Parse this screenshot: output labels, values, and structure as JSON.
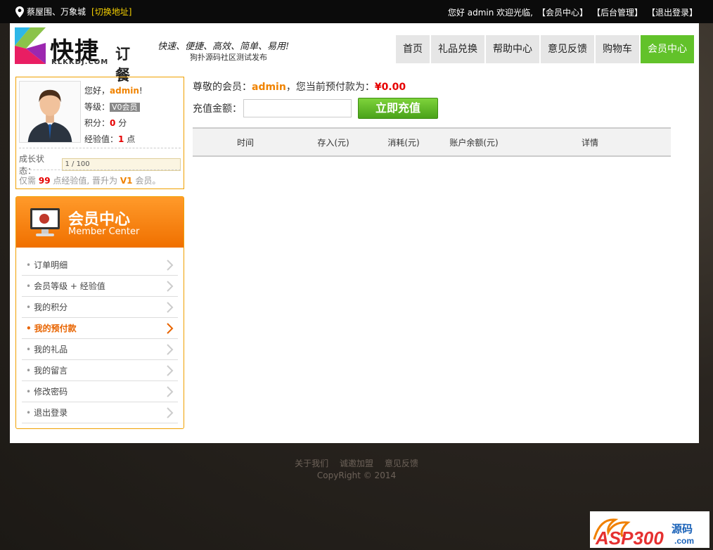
{
  "topbar": {
    "location": "蔡屋围、万象城",
    "switch_label": "[切换地址]",
    "welcome": "您好 admin 欢迎光临,",
    "links": [
      "【会员中心】",
      "【后台管理】",
      "【退出登录】"
    ]
  },
  "header": {
    "logo_name": "快捷",
    "logo_sub": "订餐",
    "logo_url": "KLKKDJ.COM",
    "slogan": "快速、便捷、高效、简单、易用!",
    "subslogan": "狗扑源码社区测试发布",
    "nav": [
      {
        "label": "首页",
        "active": false
      },
      {
        "label": "礼品兑换",
        "active": false
      },
      {
        "label": "帮助中心",
        "active": false
      },
      {
        "label": "意见反馈",
        "active": false
      },
      {
        "label": "购物车",
        "active": false
      },
      {
        "label": "会员中心",
        "active": true
      }
    ]
  },
  "profile": {
    "hello": "您好，",
    "username": "admin",
    "excl": "!",
    "level_label": "等级：",
    "level_value": "V0会员",
    "points_label": "积分：",
    "points_value": "0",
    "points_unit": "分",
    "exp_label": "经验值：",
    "exp_value": "1",
    "exp_unit": "点",
    "growth_label": "成长状态：",
    "growth_text": "1 / 100",
    "tip_pre": "仅需",
    "tip_num": "99",
    "tip_mid": "点经验值, 晋升为",
    "tip_level": "V1",
    "tip_post": "会员。"
  },
  "member_menu": {
    "title_cn": "会员中心",
    "title_en": "Member Center",
    "items": [
      {
        "label": "订单明细",
        "active": false
      },
      {
        "label": "会员等级 + 经验值",
        "active": false
      },
      {
        "label": "我的积分",
        "active": false
      },
      {
        "label": "我的预付款",
        "active": true
      },
      {
        "label": "我的礼品",
        "active": false
      },
      {
        "label": "我的留言",
        "active": false
      },
      {
        "label": "修改密码",
        "active": false
      },
      {
        "label": "退出登录",
        "active": false
      }
    ]
  },
  "main": {
    "greet_pre": "尊敬的会员：",
    "username": "admin",
    "greet_mid": "，您当前预付款为：",
    "balance": "¥0.00",
    "recharge_label": "充值金额：",
    "recharge_value": "",
    "recharge_button": "立即充值",
    "table_headers": [
      "时间",
      "存入(元)",
      "消耗(元)",
      "账户余额(元)",
      "详情"
    ]
  },
  "footer": {
    "links": [
      "关于我们",
      "诚邀加盟",
      "意见反馈"
    ],
    "copyright": "CopyRight © 2014"
  },
  "watermark": {
    "text": "ASP300源码",
    "domain": ".com"
  },
  "colors": {
    "accent": "#f08300",
    "nav_active": "#62c22a",
    "money": "#e60000"
  }
}
